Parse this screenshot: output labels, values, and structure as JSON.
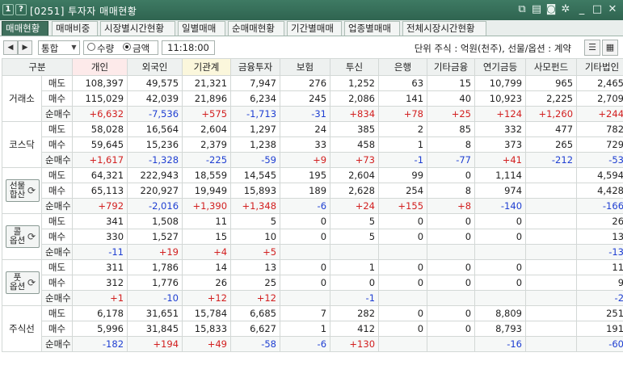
{
  "window": {
    "title": "[0251] 투자자 매매현황",
    "left_icons": [
      "dropdown-icon",
      "help-icon"
    ],
    "left_icon_glyphs": [
      "1",
      "?"
    ],
    "right_icons": [
      "link-icon",
      "memo-icon",
      "camera-icon",
      "settings-icon",
      "minimize-icon",
      "maximize-icon",
      "close-icon"
    ]
  },
  "tabs": [
    {
      "label": "매매현황",
      "active": true
    },
    {
      "label": "매매비중",
      "active": false
    },
    {
      "label": "시장별시간현황",
      "active": false
    },
    {
      "label": "일별매매",
      "active": false
    },
    {
      "label": "순매매현황",
      "active": false
    },
    {
      "label": "기간별매매",
      "active": false
    },
    {
      "label": "업종별매매",
      "active": false
    },
    {
      "label": "전체시장시간현황",
      "active": false
    }
  ],
  "toolbar": {
    "market_select": "통합",
    "radio_qty": "수량",
    "radio_amount": "금액",
    "radio_selected": "금액",
    "time": "11:18:00",
    "unit_text": "단위 주식 : 억원(천주), 선물/옵션 : 계약"
  },
  "table": {
    "columns": [
      "구분",
      "개인",
      "외국인",
      "기관계",
      "금융투자",
      "보험",
      "투신",
      "은행",
      "기타금융",
      "연기금등",
      "사모펀드",
      "기타법인"
    ],
    "sections": [
      {
        "name": "거래소",
        "button": false,
        "rows": [
          {
            "label": "매도",
            "values": [
              "108,397",
              "49,575",
              "21,321",
              "7,947",
              "276",
              "1,252",
              "63",
              "15",
              "10,799",
              "965",
              "2,465"
            ]
          },
          {
            "label": "매수",
            "values": [
              "115,029",
              "42,039",
              "21,896",
              "6,234",
              "245",
              "2,086",
              "141",
              "40",
              "10,923",
              "2,225",
              "2,709"
            ]
          },
          {
            "label": "순매수",
            "values": [
              "+6,632",
              "-7,536",
              "+575",
              "-1,713",
              "-31",
              "+834",
              "+78",
              "+25",
              "+124",
              "+1,260",
              "+244"
            ]
          }
        ]
      },
      {
        "name": "코스닥",
        "button": false,
        "rows": [
          {
            "label": "매도",
            "values": [
              "58,028",
              "16,564",
              "2,604",
              "1,297",
              "24",
              "385",
              "2",
              "85",
              "332",
              "477",
              "782"
            ]
          },
          {
            "label": "매수",
            "values": [
              "59,645",
              "15,236",
              "2,379",
              "1,238",
              "33",
              "458",
              "1",
              "8",
              "373",
              "265",
              "729"
            ]
          },
          {
            "label": "순매수",
            "values": [
              "+1,617",
              "-1,328",
              "-225",
              "-59",
              "+9",
              "+73",
              "-1",
              "-77",
              "+41",
              "-212",
              "-53"
            ]
          }
        ]
      },
      {
        "name": "선물합산",
        "button": true,
        "button_lines": [
          "선물",
          "합산"
        ],
        "rows": [
          {
            "label": "매도",
            "values": [
              "64,321",
              "222,943",
              "18,559",
              "14,545",
              "195",
              "2,604",
              "99",
              "0",
              "1,114",
              "",
              "4,594"
            ]
          },
          {
            "label": "매수",
            "values": [
              "65,113",
              "220,927",
              "19,949",
              "15,893",
              "189",
              "2,628",
              "254",
              "8",
              "974",
              "",
              "4,428"
            ]
          },
          {
            "label": "순매수",
            "values": [
              "+792",
              "-2,016",
              "+1,390",
              "+1,348",
              "-6",
              "+24",
              "+155",
              "+8",
              "-140",
              "",
              "-166"
            ]
          }
        ]
      },
      {
        "name": "콜옵션",
        "button": true,
        "button_lines": [
          "콜",
          "옵션"
        ],
        "rows": [
          {
            "label": "매도",
            "values": [
              "341",
              "1,508",
              "11",
              "5",
              "0",
              "5",
              "0",
              "0",
              "0",
              "",
              "26"
            ]
          },
          {
            "label": "매수",
            "values": [
              "330",
              "1,527",
              "15",
              "10",
              "0",
              "5",
              "0",
              "0",
              "0",
              "",
              "13"
            ]
          },
          {
            "label": "순매수",
            "values": [
              "-11",
              "+19",
              "+4",
              "+5",
              "",
              "",
              "",
              "",
              "",
              "",
              "-13"
            ]
          }
        ]
      },
      {
        "name": "풋옵션",
        "button": true,
        "button_lines": [
          "풋",
          "옵션"
        ],
        "rows": [
          {
            "label": "매도",
            "values": [
              "311",
              "1,786",
              "14",
              "13",
              "0",
              "1",
              "0",
              "0",
              "0",
              "",
              "11"
            ]
          },
          {
            "label": "매수",
            "values": [
              "312",
              "1,776",
              "26",
              "25",
              "0",
              "0",
              "0",
              "0",
              "0",
              "",
              "9"
            ]
          },
          {
            "label": "순매수",
            "values": [
              "+1",
              "-10",
              "+12",
              "+12",
              "",
              "-1",
              "",
              "",
              "",
              "",
              "-2"
            ]
          }
        ]
      },
      {
        "name": "주식선",
        "button": false,
        "rows": [
          {
            "label": "매도",
            "values": [
              "6,178",
              "31,651",
              "15,784",
              "6,685",
              "7",
              "282",
              "0",
              "0",
              "8,809",
              "",
              "251"
            ]
          },
          {
            "label": "매수",
            "values": [
              "5,996",
              "31,845",
              "15,833",
              "6,627",
              "1",
              "412",
              "0",
              "0",
              "8,793",
              "",
              "191"
            ]
          },
          {
            "label": "순매수",
            "values": [
              "-182",
              "+194",
              "+49",
              "-58",
              "-6",
              "+130",
              "",
              "",
              "-16",
              "",
              "-60"
            ]
          }
        ]
      }
    ]
  },
  "colors": {
    "positive": "#d21f1f",
    "negative": "#1f3fd2",
    "titlebar": "#2f6450",
    "active_tab": "#3f6f5c"
  }
}
